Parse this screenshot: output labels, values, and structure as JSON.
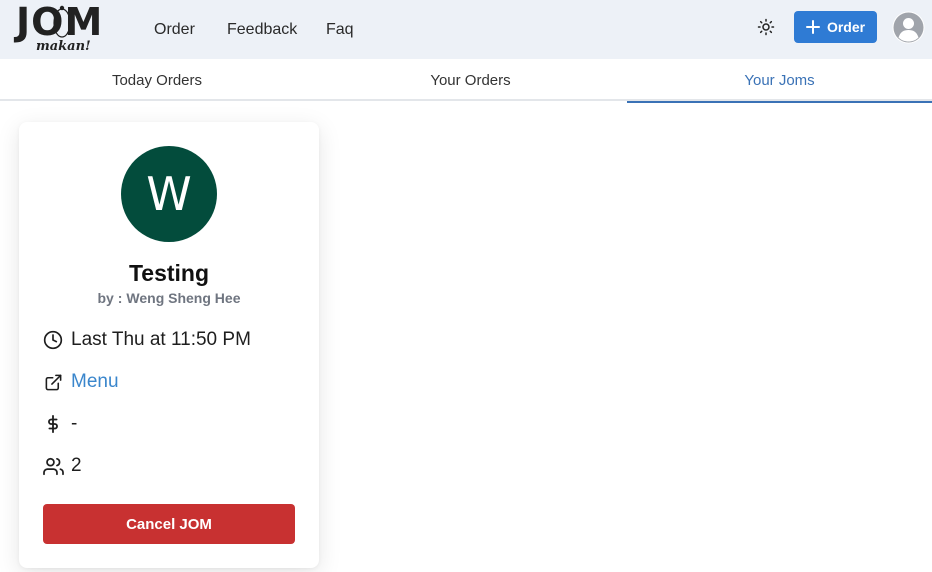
{
  "brand": {
    "logo_main": "JOM",
    "logo_sub": "makan!"
  },
  "nav": {
    "order": "Order",
    "feedback": "Feedback",
    "faq": "Faq"
  },
  "header": {
    "order_button": "Order"
  },
  "tabs": [
    {
      "label": "Today Orders",
      "active": false
    },
    {
      "label": "Your Orders",
      "active": false
    },
    {
      "label": "Your Joms",
      "active": true
    }
  ],
  "card": {
    "avatar_letter": "W",
    "title": "Testing",
    "by_prefix": "by :",
    "by_name": "Weng Sheng Hee",
    "time": "Last Thu at 11:50 PM",
    "menu_link": "Menu",
    "price": "-",
    "people": "2",
    "cancel_button": "Cancel JOM"
  },
  "colors": {
    "header_bg": "#edf1f7",
    "primary": "#2f7bd4",
    "tab_active": "#3a72b6",
    "avatar_bg": "#034c3c",
    "danger": "#c83131",
    "link": "#3a86cc"
  },
  "icons": {
    "theme": "sun-icon",
    "add": "plus-icon",
    "account": "user-circle-icon",
    "time": "clock-icon",
    "menu": "external-link-icon",
    "price": "dollar-icon",
    "people": "users-icon"
  }
}
